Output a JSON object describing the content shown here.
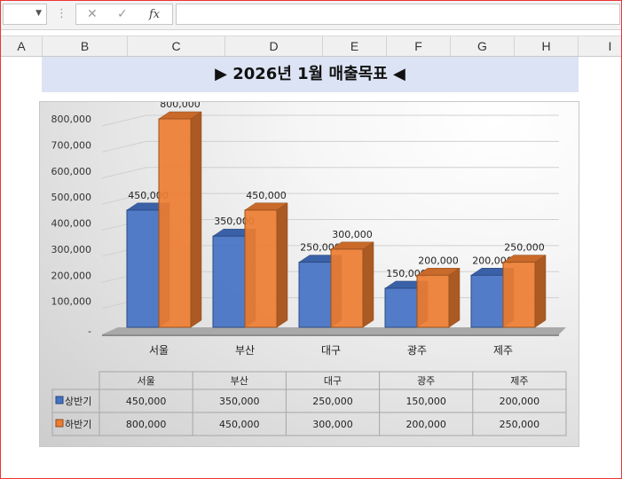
{
  "formula_bar": {
    "fx_label": "fx",
    "cancel_glyph": "✕",
    "enter_glyph": "✓",
    "dropdown_glyph": "▼",
    "dots_glyph": "⋮"
  },
  "columns": [
    "A",
    "B",
    "C",
    "D",
    "E",
    "F",
    "G",
    "H",
    "I"
  ],
  "sheet": {
    "title": "▶ 2026년 1월 매출목표 ◀",
    "title_bg": "#dce3f4"
  },
  "colors": {
    "series1": "#4472c4",
    "series2": "#ed7d31"
  },
  "chart_data": {
    "type": "bar",
    "style": "3d-clustered-column",
    "categories": [
      "서울",
      "부산",
      "대구",
      "광주",
      "제주"
    ],
    "series": [
      {
        "name": "상반기",
        "values": [
          450000,
          350000,
          250000,
          150000,
          200000
        ]
      },
      {
        "name": "하반기",
        "values": [
          800000,
          450000,
          300000,
          200000,
          250000
        ]
      }
    ],
    "data_labels": [
      [
        "450,000",
        "350,000",
        "250,000",
        "150,000",
        "200,000"
      ],
      [
        "800,000",
        "450,000",
        "300,000",
        "200,000",
        "250,000"
      ]
    ],
    "yticks": [
      "800,000",
      "700,000",
      "600,000",
      "500,000",
      "400,000",
      "300,000",
      "200,000",
      "100,000",
      "-"
    ],
    "ylim": [
      0,
      800000
    ],
    "grid": true,
    "data_table": true
  }
}
